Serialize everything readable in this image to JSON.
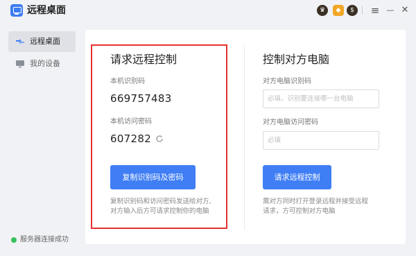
{
  "app": {
    "title": "远程桌面",
    "badges": [
      "♛",
      "◆",
      "$"
    ]
  },
  "titlebar": {
    "menu_icon": "≡",
    "minimize_icon": "—",
    "close_icon": "✕"
  },
  "sidebar": {
    "items": [
      {
        "label": "远程桌面",
        "icon": "remote-desktop-icon",
        "active": true
      },
      {
        "label": "我的设备",
        "icon": "monitor-icon",
        "active": false
      }
    ],
    "status": {
      "text": "服务器连接成功",
      "color": "#36c15a"
    }
  },
  "left_panel": {
    "title": "请求远程控制",
    "id_label": "本机识别码",
    "id_value": "669757483",
    "password_label": "本机访问密码",
    "password_value": "607282",
    "copy_button": "复制识别码及密码",
    "note_line1": "复制识别码和访问密码发送给对方,",
    "note_line2": "对方输入后方可请求控制你的电脑"
  },
  "right_panel": {
    "title": "控制对方电脑",
    "id_label": "对方电脑识别码",
    "id_placeholder": "必填，识别要连接哪一台电脑",
    "password_label": "对方电脑访问密码",
    "password_placeholder": "必填",
    "request_button": "请求远程控制",
    "note_line1": "需对方同时打开登录远程并接受远程",
    "note_line2": "请求，方可控制对方电脑"
  },
  "colors": {
    "accent": "#3f7ef4",
    "highlight_border": "#e5312f",
    "status_ok": "#36c15a"
  }
}
